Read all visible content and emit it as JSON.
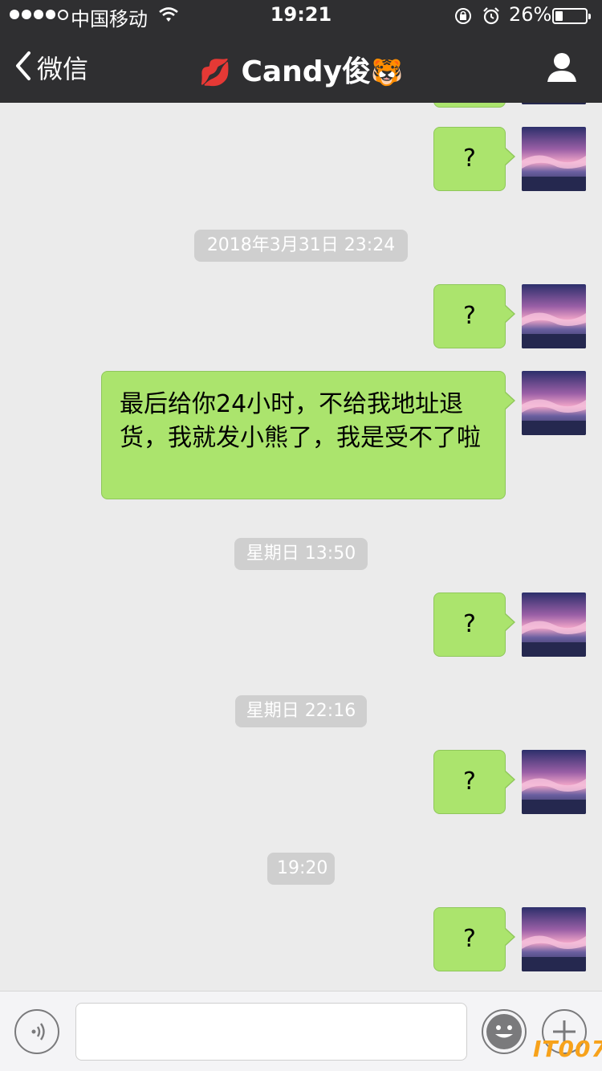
{
  "status_bar": {
    "carrier": "中国移动",
    "time": "19:21",
    "battery_pct": "26%",
    "battery_level": 0.26,
    "signal_bars": 4
  },
  "nav": {
    "back_label": "微信",
    "title_emoji_left": "💋",
    "title": "Candy俊",
    "title_emoji_right": "🐯"
  },
  "chat": {
    "timestamps": [
      "2018年3月31日 23:24",
      "星期日 13:50",
      "星期日 22:16",
      "19:20"
    ],
    "messages": [
      "?",
      "?",
      "最后给你24小时，不给我地址退货，我就发小熊了，我是受不了啦",
      "?",
      "?",
      "?"
    ]
  },
  "input": {
    "value": "",
    "placeholder": ""
  },
  "watermark": "IT007",
  "colors": {
    "bubble": "#abe46d",
    "header": "#2f2f31",
    "chat_bg": "#ebebeb"
  }
}
